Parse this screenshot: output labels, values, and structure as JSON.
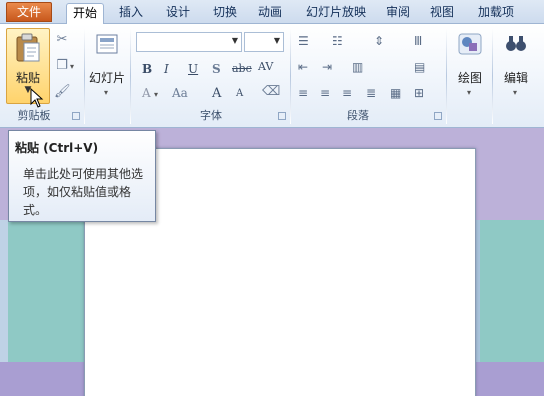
{
  "tabs": {
    "file": "文件",
    "home": "开始",
    "insert": "插入",
    "design": "设计",
    "transitions": "切换",
    "animations": "动画",
    "slideshow": "幻灯片放映",
    "review": "审阅",
    "view": "视图",
    "addins": "加载项"
  },
  "clipboard": {
    "paste_label": "粘贴",
    "group_label": "剪贴板"
  },
  "slides": {
    "new_slide_label": "幻灯片"
  },
  "font": {
    "group_label": "字体",
    "font_name": "",
    "font_size": "",
    "bold": "B",
    "italic": "I",
    "underline": "U",
    "shadow": "S",
    "strikethrough": "abc",
    "spacing": "AV",
    "font_color": "A",
    "change_case": "Aa",
    "grow": "A",
    "shrink": "A"
  },
  "paragraph": {
    "group_label": "段落"
  },
  "drawing": {
    "label": "绘图"
  },
  "editing": {
    "label": "编辑"
  },
  "tooltip": {
    "title": "粘贴 (Ctrl+V)",
    "body": "单击此处可使用其他选项，如仅粘贴值或格式。"
  },
  "colors": {
    "file_tab": "#d2692c",
    "slide_bg_top": "#bcb1d9",
    "slide_bg_teal": "#8fc9c5",
    "highlight": "#ffd36c"
  }
}
